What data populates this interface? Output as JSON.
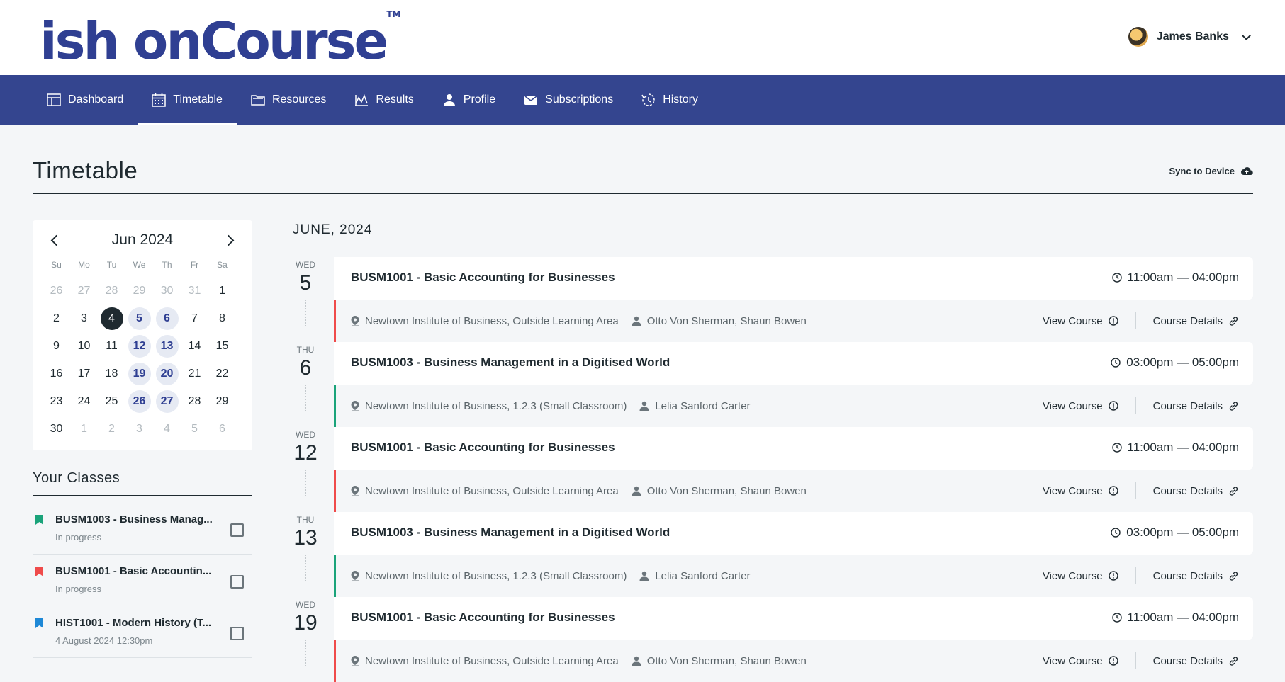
{
  "header": {
    "logo_text": "ish onCourse",
    "logo_reg": "®",
    "logo_tm": "TM",
    "user_name": "James Banks"
  },
  "nav": [
    {
      "label": "Dashboard",
      "icon": "dashboard-icon"
    },
    {
      "label": "Timetable",
      "icon": "calendar-icon",
      "active": true
    },
    {
      "label": "Resources",
      "icon": "folder-icon"
    },
    {
      "label": "Results",
      "icon": "chart-icon"
    },
    {
      "label": "Profile",
      "icon": "person-icon"
    },
    {
      "label": "Subscriptions",
      "icon": "mail-icon"
    },
    {
      "label": "History",
      "icon": "history-icon"
    }
  ],
  "page": {
    "title": "Timetable",
    "sync_label": "Sync to Device"
  },
  "calendar": {
    "month_label": "Jun 2024",
    "weekdays": [
      "Su",
      "Mo",
      "Tu",
      "We",
      "Th",
      "Fr",
      "Sa"
    ],
    "days": [
      {
        "d": "26",
        "t": "muted"
      },
      {
        "d": "27",
        "t": "muted"
      },
      {
        "d": "28",
        "t": "muted"
      },
      {
        "d": "29",
        "t": "muted"
      },
      {
        "d": "30",
        "t": "muted"
      },
      {
        "d": "31",
        "t": "muted"
      },
      {
        "d": "1",
        "t": ""
      },
      {
        "d": "2",
        "t": ""
      },
      {
        "d": "3",
        "t": ""
      },
      {
        "d": "4",
        "t": "today"
      },
      {
        "d": "5",
        "t": "event"
      },
      {
        "d": "6",
        "t": "event"
      },
      {
        "d": "7",
        "t": ""
      },
      {
        "d": "8",
        "t": ""
      },
      {
        "d": "9",
        "t": ""
      },
      {
        "d": "10",
        "t": ""
      },
      {
        "d": "11",
        "t": ""
      },
      {
        "d": "12",
        "t": "event"
      },
      {
        "d": "13",
        "t": "event"
      },
      {
        "d": "14",
        "t": ""
      },
      {
        "d": "15",
        "t": ""
      },
      {
        "d": "16",
        "t": ""
      },
      {
        "d": "17",
        "t": ""
      },
      {
        "d": "18",
        "t": ""
      },
      {
        "d": "19",
        "t": "event"
      },
      {
        "d": "20",
        "t": "event"
      },
      {
        "d": "21",
        "t": ""
      },
      {
        "d": "22",
        "t": ""
      },
      {
        "d": "23",
        "t": ""
      },
      {
        "d": "24",
        "t": ""
      },
      {
        "d": "25",
        "t": ""
      },
      {
        "d": "26",
        "t": "event"
      },
      {
        "d": "27",
        "t": "event"
      },
      {
        "d": "28",
        "t": ""
      },
      {
        "d": "29",
        "t": ""
      },
      {
        "d": "30",
        "t": ""
      },
      {
        "d": "1",
        "t": "muted"
      },
      {
        "d": "2",
        "t": "muted"
      },
      {
        "d": "3",
        "t": "muted"
      },
      {
        "d": "4",
        "t": "muted"
      },
      {
        "d": "5",
        "t": "muted"
      },
      {
        "d": "6",
        "t": "muted"
      }
    ]
  },
  "classes": {
    "title": "Your Classes",
    "items": [
      {
        "name": "BUSM1003 - Business Manag...",
        "status": "In progress",
        "color": "#1aa37a"
      },
      {
        "name": "BUSM1001 - Basic Accountin...",
        "status": "In progress",
        "color": "#ef4b4b"
      },
      {
        "name": "HIST1001 - Modern History (T...",
        "status": "4 August 2024 12:30pm",
        "color": "#1e88d6"
      }
    ]
  },
  "timetable": {
    "month_label": "JUNE, 2024",
    "view_course_label": "View Course",
    "course_details_label": "Course Details",
    "events": [
      {
        "dow": "WED",
        "day": "5",
        "title": "BUSM1001 - Basic Accounting for Businesses",
        "time": "11:00am — 04:00pm",
        "location": "Newtown Institute of Business, Outside Learning Area",
        "tutors": "Otto Von Sherman, Shaun Bowen",
        "color": "#ef4b4b"
      },
      {
        "dow": "THU",
        "day": "6",
        "title": "BUSM1003 - Business Management in a Digitised World",
        "time": "03:00pm — 05:00pm",
        "location": "Newtown Institute of Business, 1.2.3 (Small Classroom)",
        "tutors": "Lelia Sanford Carter",
        "color": "#1aa37a"
      },
      {
        "dow": "WED",
        "day": "12",
        "title": "BUSM1001 - Basic Accounting for Businesses",
        "time": "11:00am — 04:00pm",
        "location": "Newtown Institute of Business, Outside Learning Area",
        "tutors": "Otto Von Sherman, Shaun Bowen",
        "color": "#ef4b4b"
      },
      {
        "dow": "THU",
        "day": "13",
        "title": "BUSM1003 - Business Management in a Digitised World",
        "time": "03:00pm — 05:00pm",
        "location": "Newtown Institute of Business, 1.2.3 (Small Classroom)",
        "tutors": "Lelia Sanford Carter",
        "color": "#1aa37a"
      },
      {
        "dow": "WED",
        "day": "19",
        "title": "BUSM1001 - Basic Accounting for Businesses",
        "time": "11:00am — 04:00pm",
        "location": "Newtown Institute of Business, Outside Learning Area",
        "tutors": "Otto Von Sherman, Shaun Bowen",
        "color": "#ef4b4b"
      }
    ]
  }
}
